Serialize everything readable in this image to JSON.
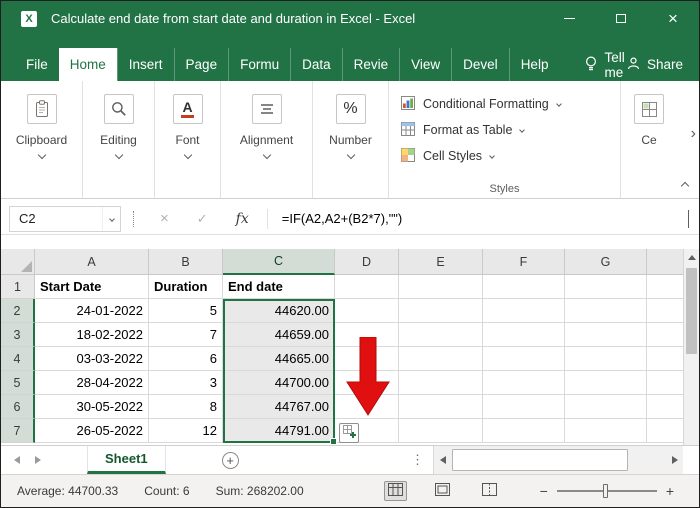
{
  "window": {
    "title": "Calculate end date from start date and duration in Excel  -  Excel"
  },
  "ribbon": {
    "tabs": [
      {
        "label": "File",
        "active": false
      },
      {
        "label": "Home",
        "active": true
      },
      {
        "label": "Insert",
        "active": false
      },
      {
        "label": "Page",
        "active": false
      },
      {
        "label": "Formu",
        "active": false
      },
      {
        "label": "Data",
        "active": false
      },
      {
        "label": "Revie",
        "active": false
      },
      {
        "label": "View",
        "active": false
      },
      {
        "label": "Devel",
        "active": false
      },
      {
        "label": "Help",
        "active": false
      }
    ],
    "tell_me": "Tell me",
    "share": "Share",
    "groups": [
      {
        "label": "Clipboard",
        "icon": "clipboard-icon"
      },
      {
        "label": "Editing",
        "icon": "search-icon"
      },
      {
        "label": "Font",
        "icon": "font-underline-icon"
      },
      {
        "label": "Alignment",
        "icon": "align-lines-icon"
      },
      {
        "label": "Number",
        "icon": "percent-icon"
      }
    ],
    "styles_group": {
      "label": "Styles",
      "items": [
        {
          "label": "Conditional Formatting"
        },
        {
          "label": "Format as Table"
        },
        {
          "label": "Cell Styles"
        }
      ]
    },
    "cells_group_label": "Ce"
  },
  "formula_bar": {
    "name_box": "C2",
    "cancel": "×",
    "enter": "✓",
    "fx": "fx",
    "formula": "=IF(A2,A2+(B2*7),\"\")"
  },
  "sheet": {
    "column_headers": [
      "A",
      "B",
      "C",
      "D",
      "E",
      "F",
      "G"
    ],
    "selected_range": "C2:C7",
    "rows": [
      {
        "num": "1",
        "a": "Start Date",
        "b": "Duration",
        "c": "End date"
      },
      {
        "num": "2",
        "a": "24-01-2022",
        "b": "5",
        "c": "44620.00"
      },
      {
        "num": "3",
        "a": "18-02-2022",
        "b": "7",
        "c": "44659.00"
      },
      {
        "num": "4",
        "a": "03-03-2022",
        "b": "6",
        "c": "44665.00"
      },
      {
        "num": "5",
        "a": "28-04-2022",
        "b": "3",
        "c": "44700.00"
      },
      {
        "num": "6",
        "a": "30-05-2022",
        "b": "8",
        "c": "44767.00"
      },
      {
        "num": "7",
        "a": "26-05-2022",
        "b": "12",
        "c": "44791.00"
      }
    ]
  },
  "sheet_tabs": {
    "active_tab": "Sheet1",
    "new_sheet": "+"
  },
  "status_bar": {
    "average": "Average: 44700.33",
    "count": "Count: 6",
    "sum": "Sum: 268202.00",
    "zoom_out": "−",
    "zoom_in": "+"
  },
  "colors": {
    "excel_green": "#217346",
    "selection_fill": "#e9e9e9",
    "header_select_fill": "#d3ddd6",
    "arrow_red": "#e01010"
  }
}
